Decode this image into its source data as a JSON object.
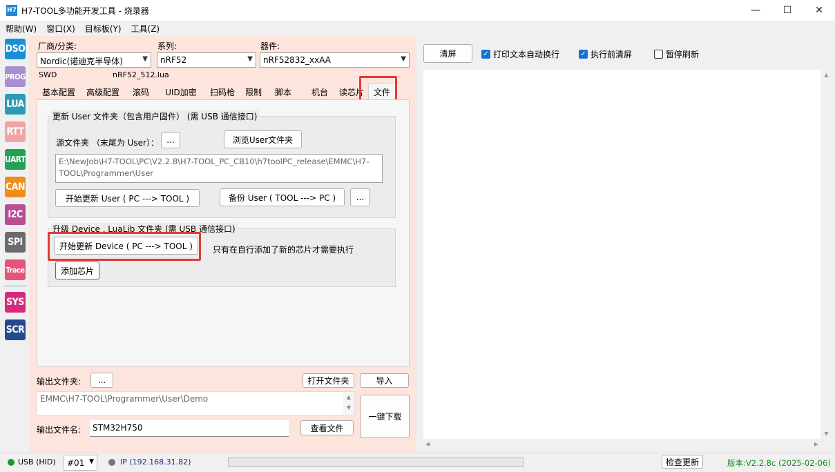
{
  "window": {
    "app_icon": "H7",
    "title": "H7-TOOL多功能开发工具 - 烧录器",
    "minimize": "—",
    "maximize": "☐",
    "close": "✕"
  },
  "menu": [
    "帮助(W)",
    "窗口(X)",
    "目标板(Y)",
    "工具(Z)"
  ],
  "tools": [
    {
      "label": "DSO",
      "color": "#1b8fd6"
    },
    {
      "label": "PROG",
      "color": "#a98fd0"
    },
    {
      "label": "LUA",
      "color": "#2d9bb5"
    },
    {
      "label": "RTT",
      "color": "#f0a5a5"
    },
    {
      "label": "UART",
      "color": "#23a256"
    },
    {
      "label": "CAN",
      "color": "#ef8c1a"
    },
    {
      "label": "I2C",
      "color": "#b94e95"
    },
    {
      "label": "SPI",
      "color": "#6b6b6b"
    },
    {
      "label": "Trace",
      "color": "#e3557a"
    },
    {
      "label": "SYS",
      "color": "#d62a7a"
    },
    {
      "label": "SCR",
      "color": "#274a8c"
    }
  ],
  "selectors": {
    "vendor_label": "厂商/分类:",
    "vendor_value": "Nordic(诺迪克半导体)",
    "series_label": "系列:",
    "series_value": "nRF52",
    "device_label": "器件:",
    "device_value": "nRF52832_xxAA",
    "interface": "SWD",
    "lua_file": "nRF52_512.lua"
  },
  "tabs": [
    "基本配置",
    "高级配置",
    "滚码",
    "UID加密",
    "扫码枪",
    "限制",
    "脚本",
    "机台",
    "读芯片",
    "文件"
  ],
  "active_tab": "文件",
  "user_group": {
    "title": "更新 User 文件夹（包含用户固件）   (需 USB 通信接口)",
    "source_label": "源文件夹 （末尾为 User）：",
    "browse_small": "...",
    "browse_button": "浏览User文件夹",
    "path": "E:\\NewJob\\H7-TOOL\\PC\\V2.2.8\\H7-TOOL_PC_CB10\\h7toolPC_release\\EMMC\\H7-TOOL\\Programmer\\User",
    "start_update": "开始更新 User ( PC ---> TOOL )",
    "backup": "备份 User ( TOOL ---> PC )",
    "more": "..."
  },
  "device_group": {
    "title": "升级 Device ,   LuaLib 文件夹     (需 USB 通信接口)",
    "start_update": "开始更新 Device ( PC ---> TOOL )",
    "note": "只有在自行添加了新的芯片才需要执行",
    "add_chip": "添加芯片"
  },
  "output": {
    "folder_label": "输出文件夹:",
    "folder_browse": "...",
    "open_folder": "打开文件夹",
    "import": "导入",
    "folder_path": "EMMC\\H7-TOOL\\Programmer\\User\\Demo",
    "name_label": "输出文件名:",
    "name_value": "STM32H750",
    "view_file": "查看文件",
    "one_key": "一键下载"
  },
  "right": {
    "clear": "清屏",
    "wrap": "打印文本自动换行",
    "wrap_checked": true,
    "clear_before": "执行前清屏",
    "clear_before_checked": true,
    "pause": "暂停刷新",
    "pause_checked": false
  },
  "status": {
    "usb": "USB (HID)",
    "usb_color": "#1a9a2a",
    "port": "#01",
    "ip": "IP (192.168.31.82)",
    "ip_color": "#777777",
    "progress": 0,
    "check_update": "检查更新",
    "version": "版本:V2.2.8c (2025-02-06)",
    "version_color": "#1a8a1a"
  }
}
